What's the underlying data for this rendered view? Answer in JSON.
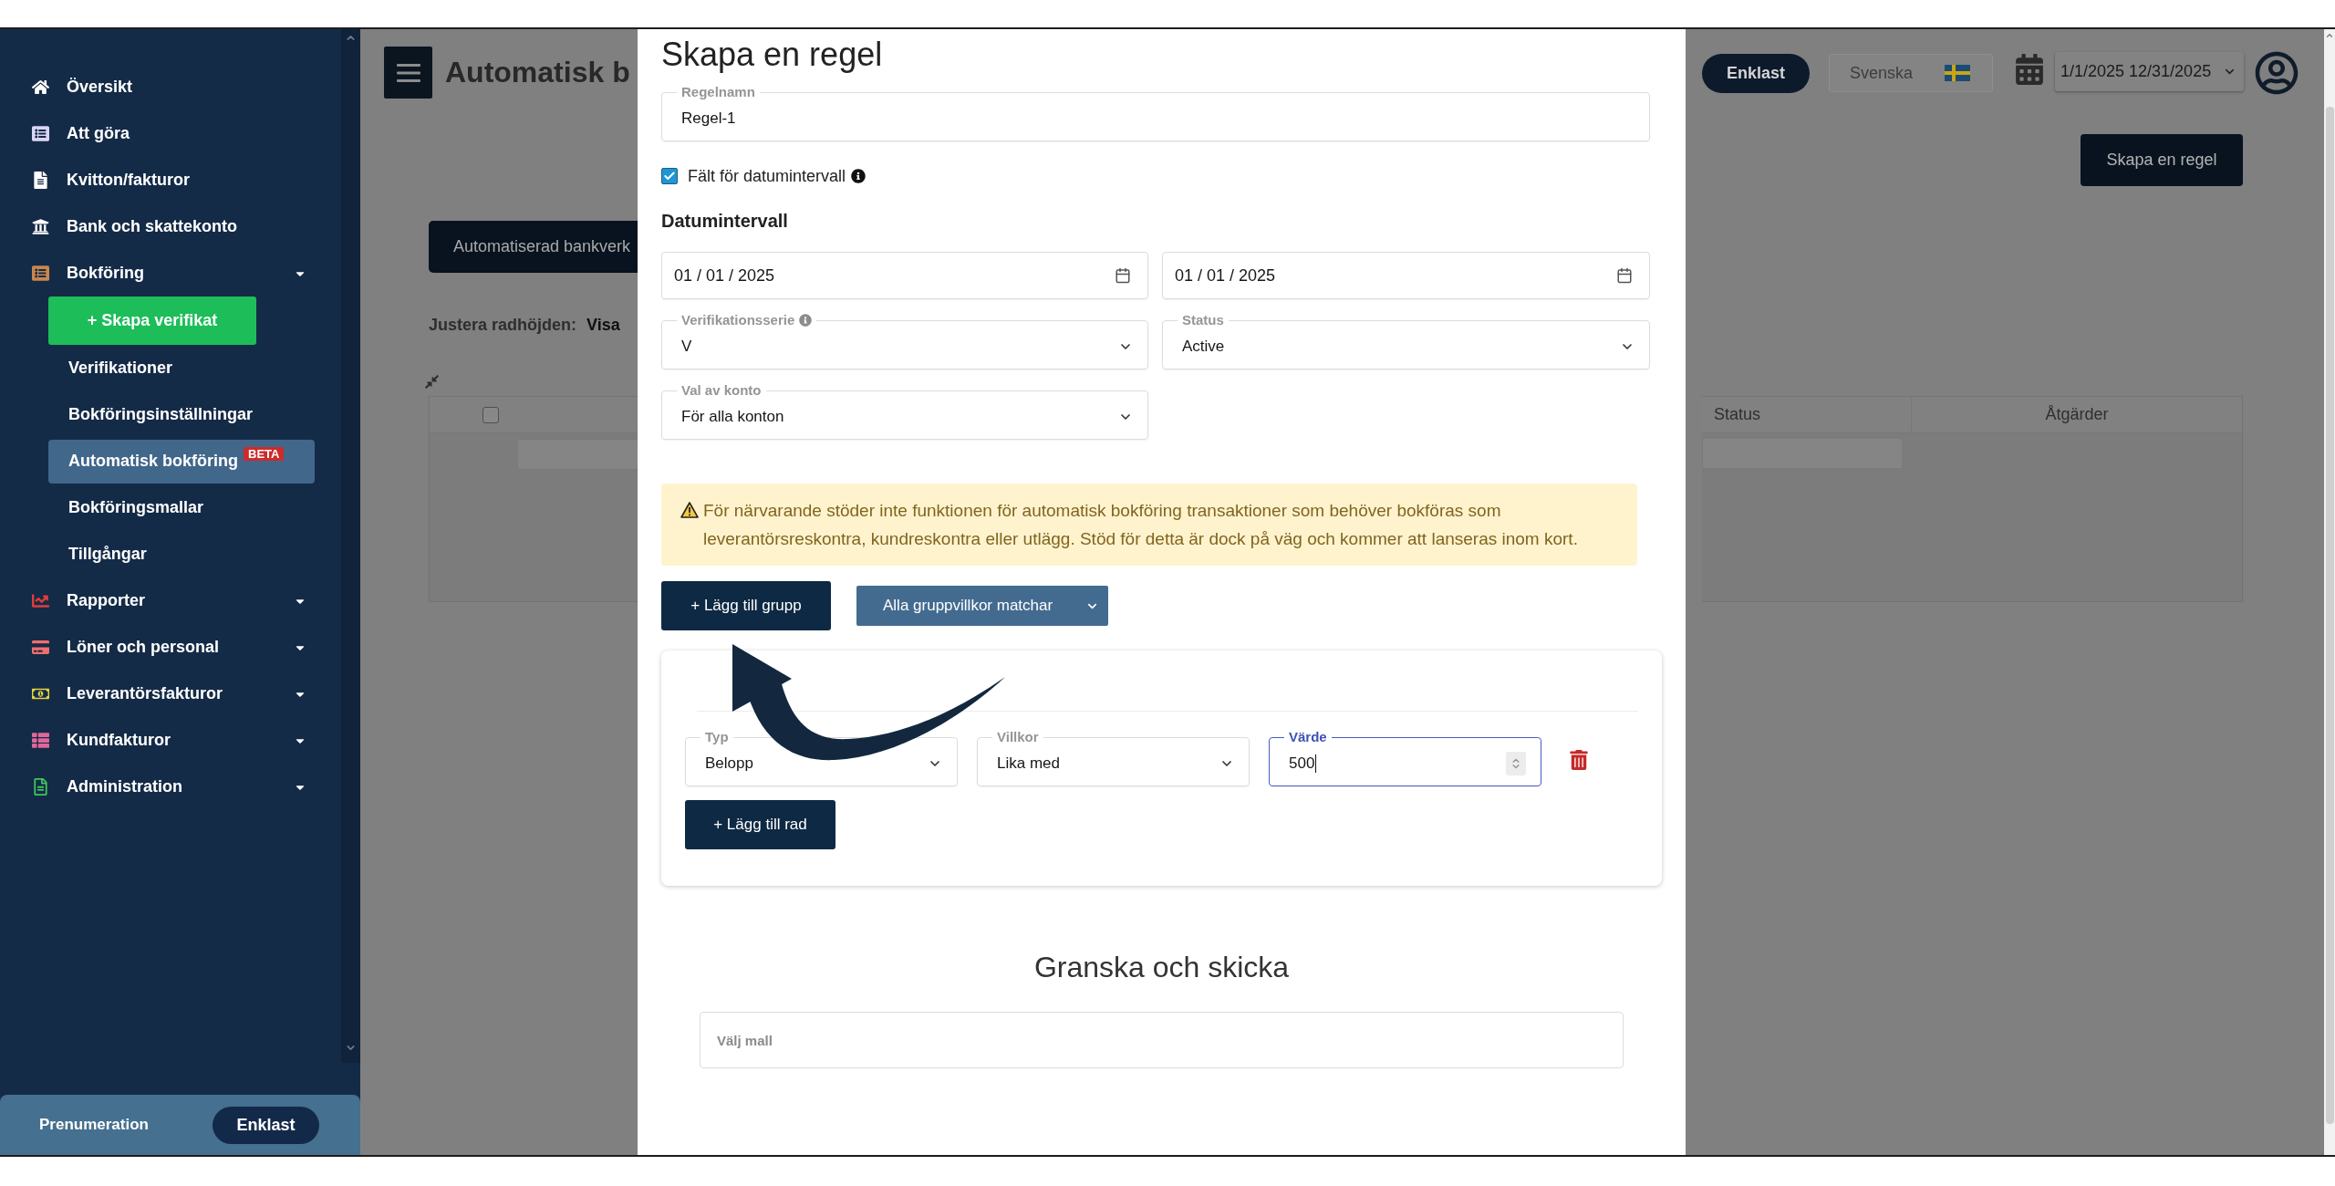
{
  "sidebar": {
    "items": [
      {
        "label": "Översikt",
        "kind": "link",
        "selected": false
      },
      {
        "label": "Att göra",
        "kind": "link",
        "selected": false
      },
      {
        "label": "Kvitton/fakturor",
        "kind": "link",
        "selected": false
      },
      {
        "label": "Bank och skattekonto",
        "kind": "link",
        "selected": false
      },
      {
        "label": "Bokföring",
        "kind": "group",
        "selected": false,
        "action": "+ Skapa verifikat",
        "children": [
          {
            "label": "Verifikationer",
            "selected": false
          },
          {
            "label": "Bokföringsinställningar",
            "selected": false
          },
          {
            "label": "Automatisk bokföring",
            "selected": true,
            "badge": "BETA"
          },
          {
            "label": "Bokföringsmallar",
            "selected": false
          },
          {
            "label": "Tillgångar",
            "selected": false
          }
        ]
      },
      {
        "label": "Rapporter",
        "kind": "group",
        "selected": false
      },
      {
        "label": "Löner och personal",
        "kind": "group",
        "selected": false
      },
      {
        "label": "Leverantörsfakturor",
        "kind": "group",
        "selected": false
      },
      {
        "label": "Kundfakturor",
        "kind": "group",
        "selected": false
      },
      {
        "label": "Administration",
        "kind": "group",
        "selected": false
      }
    ],
    "footer": {
      "label": "Prenumeration",
      "plan": "Enklast"
    }
  },
  "page": {
    "title": "Automatisk b",
    "tab_button": "Automatiserad bankverk",
    "row_height": {
      "label": "Justera radhöjden:",
      "value": "Visa"
    },
    "table": {
      "select_all": {
        "checked": false
      },
      "columns": [
        "Status",
        "Åtgärder"
      ]
    }
  },
  "header": {
    "plan": "Enklast",
    "language": "Svenska",
    "date_range": "1/1/2025 12/31/2025",
    "create_button": "Skapa en regel"
  },
  "modal": {
    "title": "Skapa en regel",
    "rule_name": {
      "label": "Regelnamn",
      "value": "Regel-1"
    },
    "date_toggle": {
      "label": "Fält för datumintervall",
      "checked": true,
      "info": true
    },
    "date_range": {
      "heading": "Datumintervall",
      "from": "01 / 01 / 2025",
      "to": "01 / 01 / 2025"
    },
    "selects": [
      {
        "label": "Verifikationsserie",
        "value": "V",
        "info": true
      },
      {
        "label": "Status",
        "value": "Active",
        "info": false
      },
      {
        "label": "Val av konto",
        "value": "För alla konton",
        "info": false
      }
    ],
    "warning": "För närvarande stöder inte funktionen för automatisk bokföring transaktioner som behöver bokföras som leverantörsreskontra, kundreskontra eller utlägg. Stöd för detta är dock på väg och kommer att lanseras inom kort.",
    "add_group": "+ Lägg till grupp",
    "match_mode": "Alla gruppvillkor matchar",
    "group": {
      "conditions": [
        {
          "type": {
            "label": "Typ",
            "value": "Belopp"
          },
          "operator": {
            "label": "Villkor",
            "value": "Lika med"
          },
          "amount": {
            "label": "Värde",
            "value": "500",
            "focused": true
          }
        }
      ],
      "add_row": "+ Lägg till rad"
    },
    "review": {
      "heading": "Granska och skicka",
      "template": {
        "placeholder": "Välj mall"
      }
    }
  }
}
